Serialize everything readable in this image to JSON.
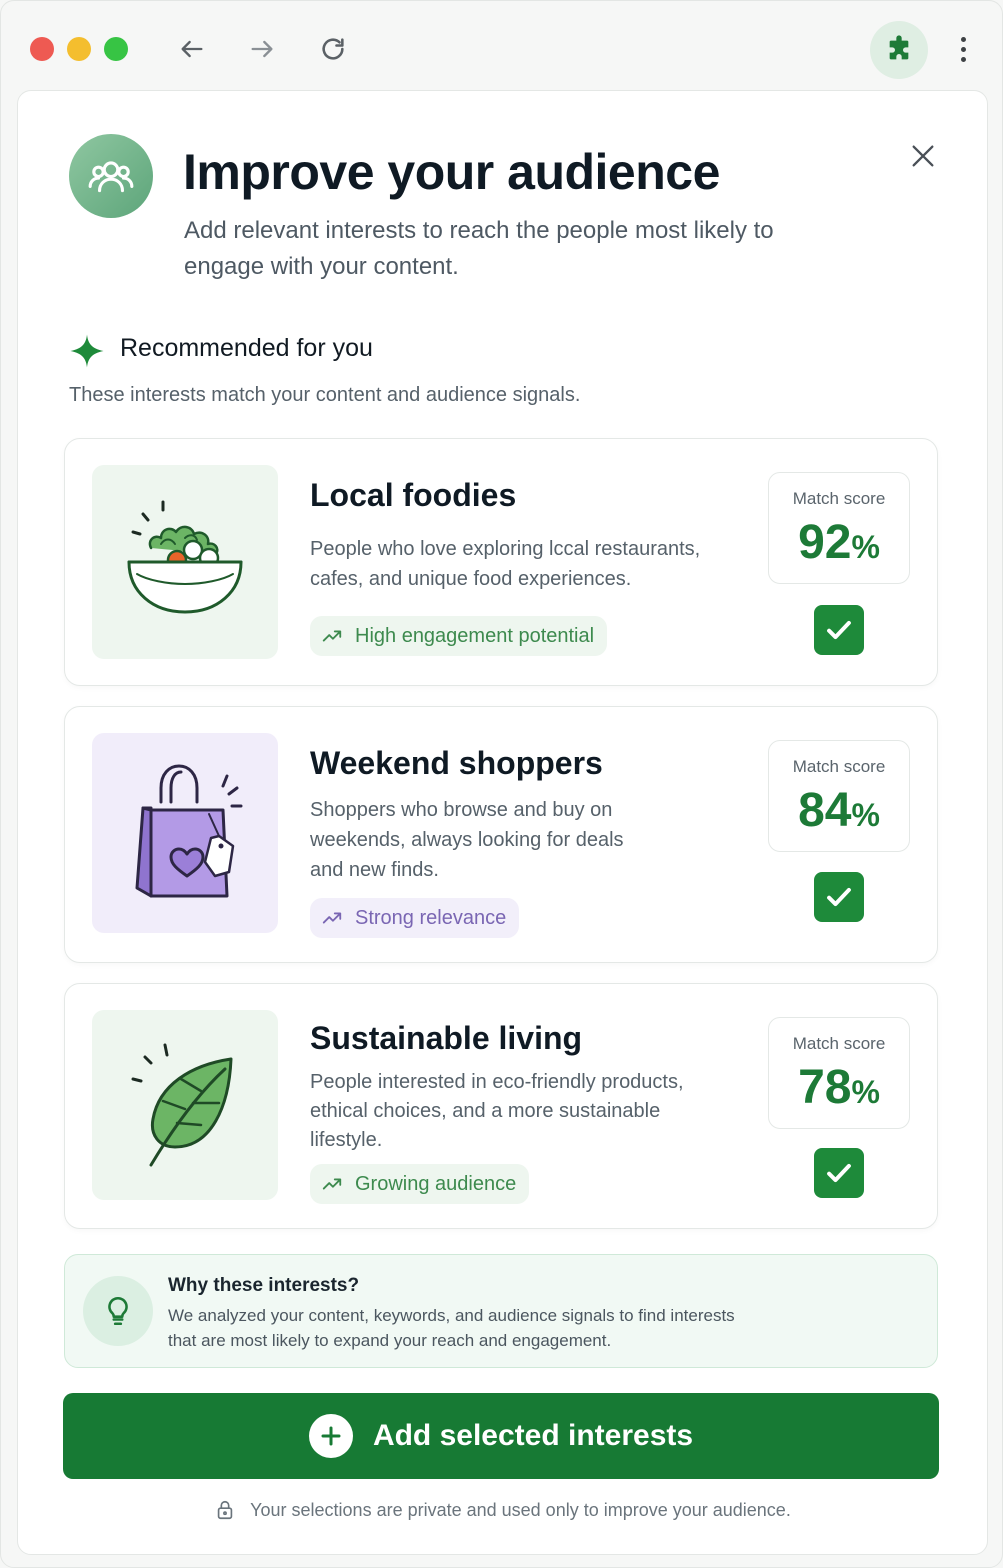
{
  "browser": {
    "icons": [
      "back-arrow-icon",
      "forward-arrow-icon",
      "reload-icon",
      "extension-puzzle-icon",
      "kebab-menu-icon"
    ]
  },
  "header": {
    "title": "Improve your audience",
    "subtitle": "Add relevant interests to reach the people most likely to engage with your content."
  },
  "recommended": {
    "title": "Recommended for you",
    "subtitle": "These interests match your content and audience signals."
  },
  "cards": [
    {
      "title": "Local foodies",
      "description": "People who love exploring lccal restaurants, cafes, and unique food experiences.",
      "tag": "High engagement potential",
      "score_label": "Match score",
      "score": "92",
      "score_unit": "%",
      "selected": true,
      "image": "salad-bowl-illustration"
    },
    {
      "title": "Weekend shoppers",
      "description": "Shoppers who browse and buy on weekends, always looking for deals and new finds.",
      "tag": "Strong relevance",
      "score_label": "Match score",
      "score": "84",
      "score_unit": "%",
      "selected": true,
      "image": "shopping-bag-illustration"
    },
    {
      "title": "Sustainable living",
      "description": "People interested in eco-friendly products, ethical choices, and a more sustainable lifestyle.",
      "tag": "Growing audience",
      "score_label": "Match score",
      "score": "78",
      "score_unit": "%",
      "selected": true,
      "image": "leaf-illustration"
    }
  ],
  "info": {
    "title": "Why these interests?",
    "text": "We analyzed your content, keywords, and audience signals to find interests that are most likely to expand your reach and engagement."
  },
  "cta": {
    "label": "Add selected interests"
  },
  "privacy": {
    "text": "Your selections are private and used only to improve your audience."
  },
  "colors": {
    "primary": "#177a34",
    "score": "#1d7a37",
    "purple_accent": "#7a66b3"
  }
}
